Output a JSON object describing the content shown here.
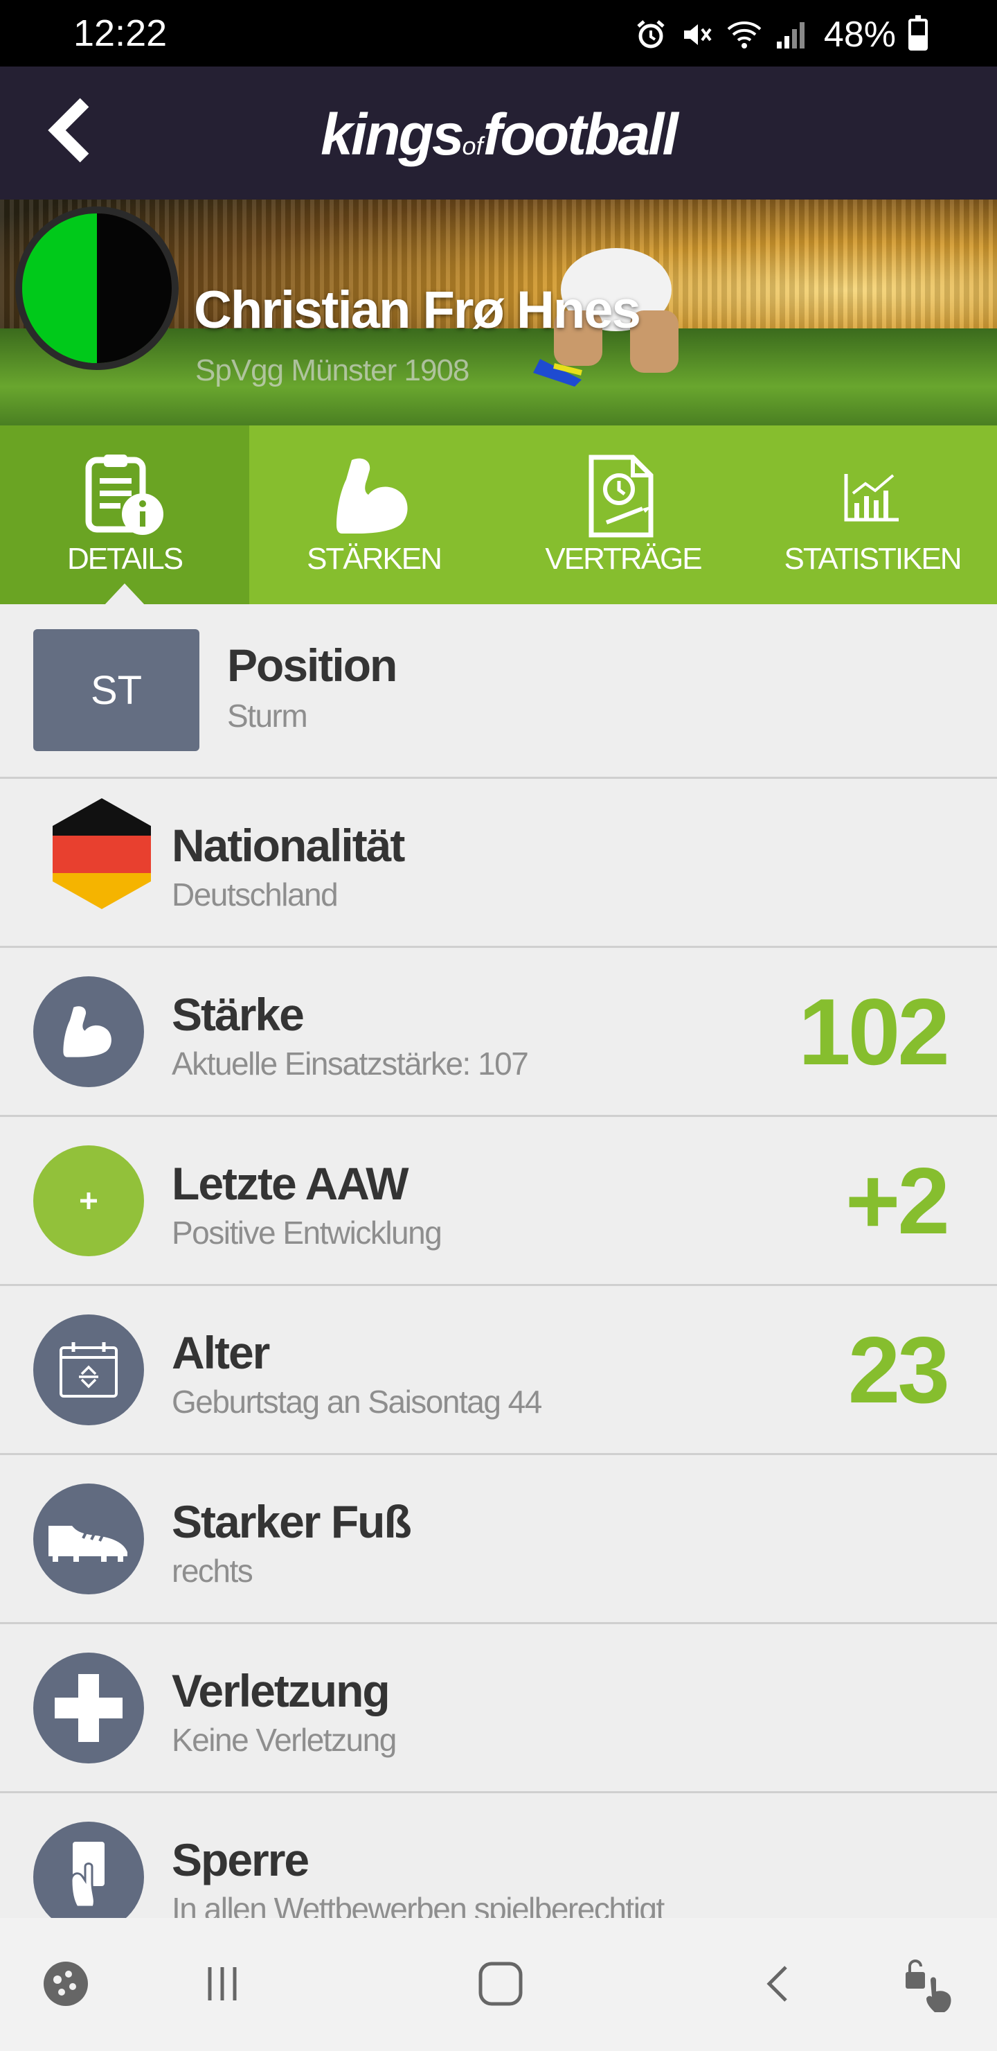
{
  "status_bar": {
    "time": "12:22",
    "battery": "48%"
  },
  "header": {
    "logo_main1": "kings",
    "logo_of": "of",
    "logo_main2": "football"
  },
  "player": {
    "name": "Christian Frø Hnes",
    "club": "SpVgg Münster 1908"
  },
  "colors": {
    "accent": "#86be2e",
    "tab_active": "#6aa423",
    "icon_bg": "#616b80",
    "header_bg": "#252033"
  },
  "tabs": [
    {
      "label": "DETAILS",
      "icon": "document-info-icon",
      "active": true
    },
    {
      "label": "STÄRKEN",
      "icon": "flexed-arm-icon",
      "active": false
    },
    {
      "label": "VERTRÄGE",
      "icon": "contract-icon",
      "active": false
    },
    {
      "label": "STATISTIKEN",
      "icon": "bar-chart-icon",
      "active": false
    }
  ],
  "details": {
    "position": {
      "badge": "ST",
      "title": "Position",
      "subtitle": "Sturm"
    },
    "nationality": {
      "title": "Nationalität",
      "subtitle": "Deutschland",
      "icon": "germany-flag-icon"
    },
    "strength": {
      "title": "Stärke",
      "subtitle": "Aktuelle Einsatzstärke: 107",
      "value": "102",
      "icon": "flexed-arm-icon"
    },
    "aaw": {
      "title": "Letzte AAW",
      "subtitle": "Positive Entwicklung",
      "value": "+2",
      "icon": "plus-icon"
    },
    "age": {
      "title": "Alter",
      "subtitle": "Geburtstag an Saisontag 44",
      "value": "23",
      "icon": "calendar-icon"
    },
    "foot": {
      "title": "Starker Fuß",
      "subtitle": "rechts",
      "icon": "boot-icon"
    },
    "injury": {
      "title": "Verletzung",
      "subtitle": "Keine Verletzung",
      "icon": "medical-cross-icon"
    },
    "suspension": {
      "title": "Sperre",
      "subtitle": "In allen Wettbewerben spielberechtigt",
      "icon": "card-hand-icon"
    }
  },
  "nav": [
    "game-launcher-icon",
    "recent-apps-icon",
    "home-icon",
    "back-icon",
    "lock-touch-icon"
  ]
}
